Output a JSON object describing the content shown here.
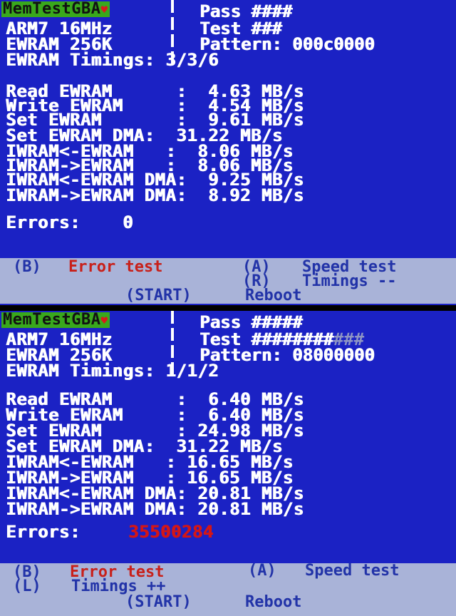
{
  "screen1": {
    "logo": "MemTestGBA",
    "heart": "♥",
    "header": {
      "line1": "Pass ####",
      "line2_left": "ARM7 16MHz",
      "line2_right": "Test ###",
      "line3_left": "EWRAM 256K",
      "line3_right": "Pattern: 000c0000",
      "line4": "EWRAM Timings: 3/3/6"
    },
    "results": [
      "Read EWRAM      :  4.63 MB/s",
      "Write EWRAM     :  4.54 MB/s",
      "Set EWRAM       :  9.61 MB/s",
      "Set EWRAM DMA:  31.22 MB/s",
      "IWRAM<-EWRAM   :  8.06 MB/s",
      "IWRAM->EWRAM   :  8.06 MB/s",
      "IWRAM<-EWRAM DMA:  9.25 MB/s",
      "IWRAM->EWRAM DMA:  8.92 MB/s"
    ],
    "errors_label": "Errors:",
    "errors_value": "0",
    "footer": {
      "b_key": "(B)",
      "b_action": "Error test",
      "a_key": "(A)",
      "a_action": "Speed test",
      "r_key": "(R)",
      "r_action": "Timings --",
      "start_key": "(START)",
      "start_action": "Reboot"
    }
  },
  "screen2": {
    "logo": "MemTestGBA",
    "heart": "♥",
    "header": {
      "line1": "Pass #####",
      "line2_left": "ARM7 16MHz",
      "line2_right": "Test ########",
      "line2_right_dim": "###",
      "line3_left": "EWRAM 256K",
      "line3_right": "Pattern: 08000000",
      "line4": "EWRAM Timings: 1/1/2"
    },
    "results": [
      "Read EWRAM      :  6.40 MB/s",
      "Write EWRAM     :  6.40 MB/s",
      "Set EWRAM       : 24.98 MB/s",
      "Set EWRAM DMA:  31.22 MB/s",
      "IWRAM<-EWRAM   : 16.65 MB/s",
      "IWRAM->EWRAM   : 16.65 MB/s",
      "IWRAM<-EWRAM DMA: 20.81 MB/s",
      "IWRAM->EWRAM DMA: 20.81 MB/s"
    ],
    "errors_label": "Errors:",
    "errors_value": "35500284",
    "footer": {
      "b_key": "(B)",
      "b_action": "Error test",
      "a_key": "(A)",
      "a_action": "Speed test",
      "l_key": "(L)",
      "l_action": "Timings ++",
      "start_key": "(START)",
      "start_action": "Reboot"
    }
  },
  "colors": {
    "screen_bg": "#1b22c4",
    "logo_bg": "#39a81c",
    "footer_bg": "#a9b3d8",
    "footer_text": "#2233a8",
    "accent_red": "#c8201a"
  }
}
